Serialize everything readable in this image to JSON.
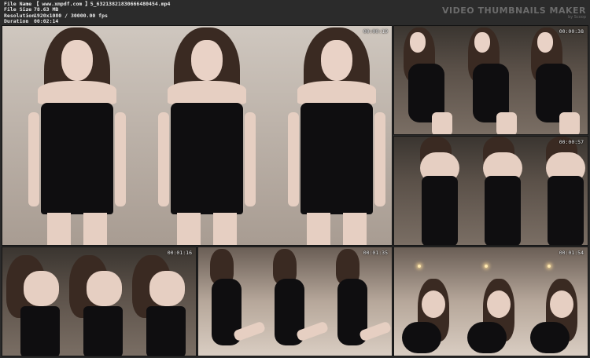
{
  "file_info": {
    "rows": [
      {
        "key": "File Name",
        "value": "【 www.xmpdf.com 】5_63213821830666480454.mp4"
      },
      {
        "key": "File Size",
        "value": "78.63 MB"
      },
      {
        "key": "Resolution",
        "value": "1920x1080 / 30000.00 fps"
      },
      {
        "key": "Duration",
        "value": "00:02:14"
      }
    ],
    "separator": ":"
  },
  "brand": {
    "title": "VIDEO THUMBNAILS MAKER",
    "subtitle": "by Scoop"
  },
  "thumbnails": [
    {
      "timestamp": "00:00:19"
    },
    {
      "timestamp": "00:00:38"
    },
    {
      "timestamp": "00:00:57"
    },
    {
      "timestamp": "00:01:16"
    },
    {
      "timestamp": "00:01:35"
    },
    {
      "timestamp": "00:01:54"
    }
  ],
  "colors": {
    "background": "#2a2a2a",
    "header_text": "#e8e8e8",
    "brand_text": "#6b6b6b",
    "dress": "#0f0e10"
  }
}
